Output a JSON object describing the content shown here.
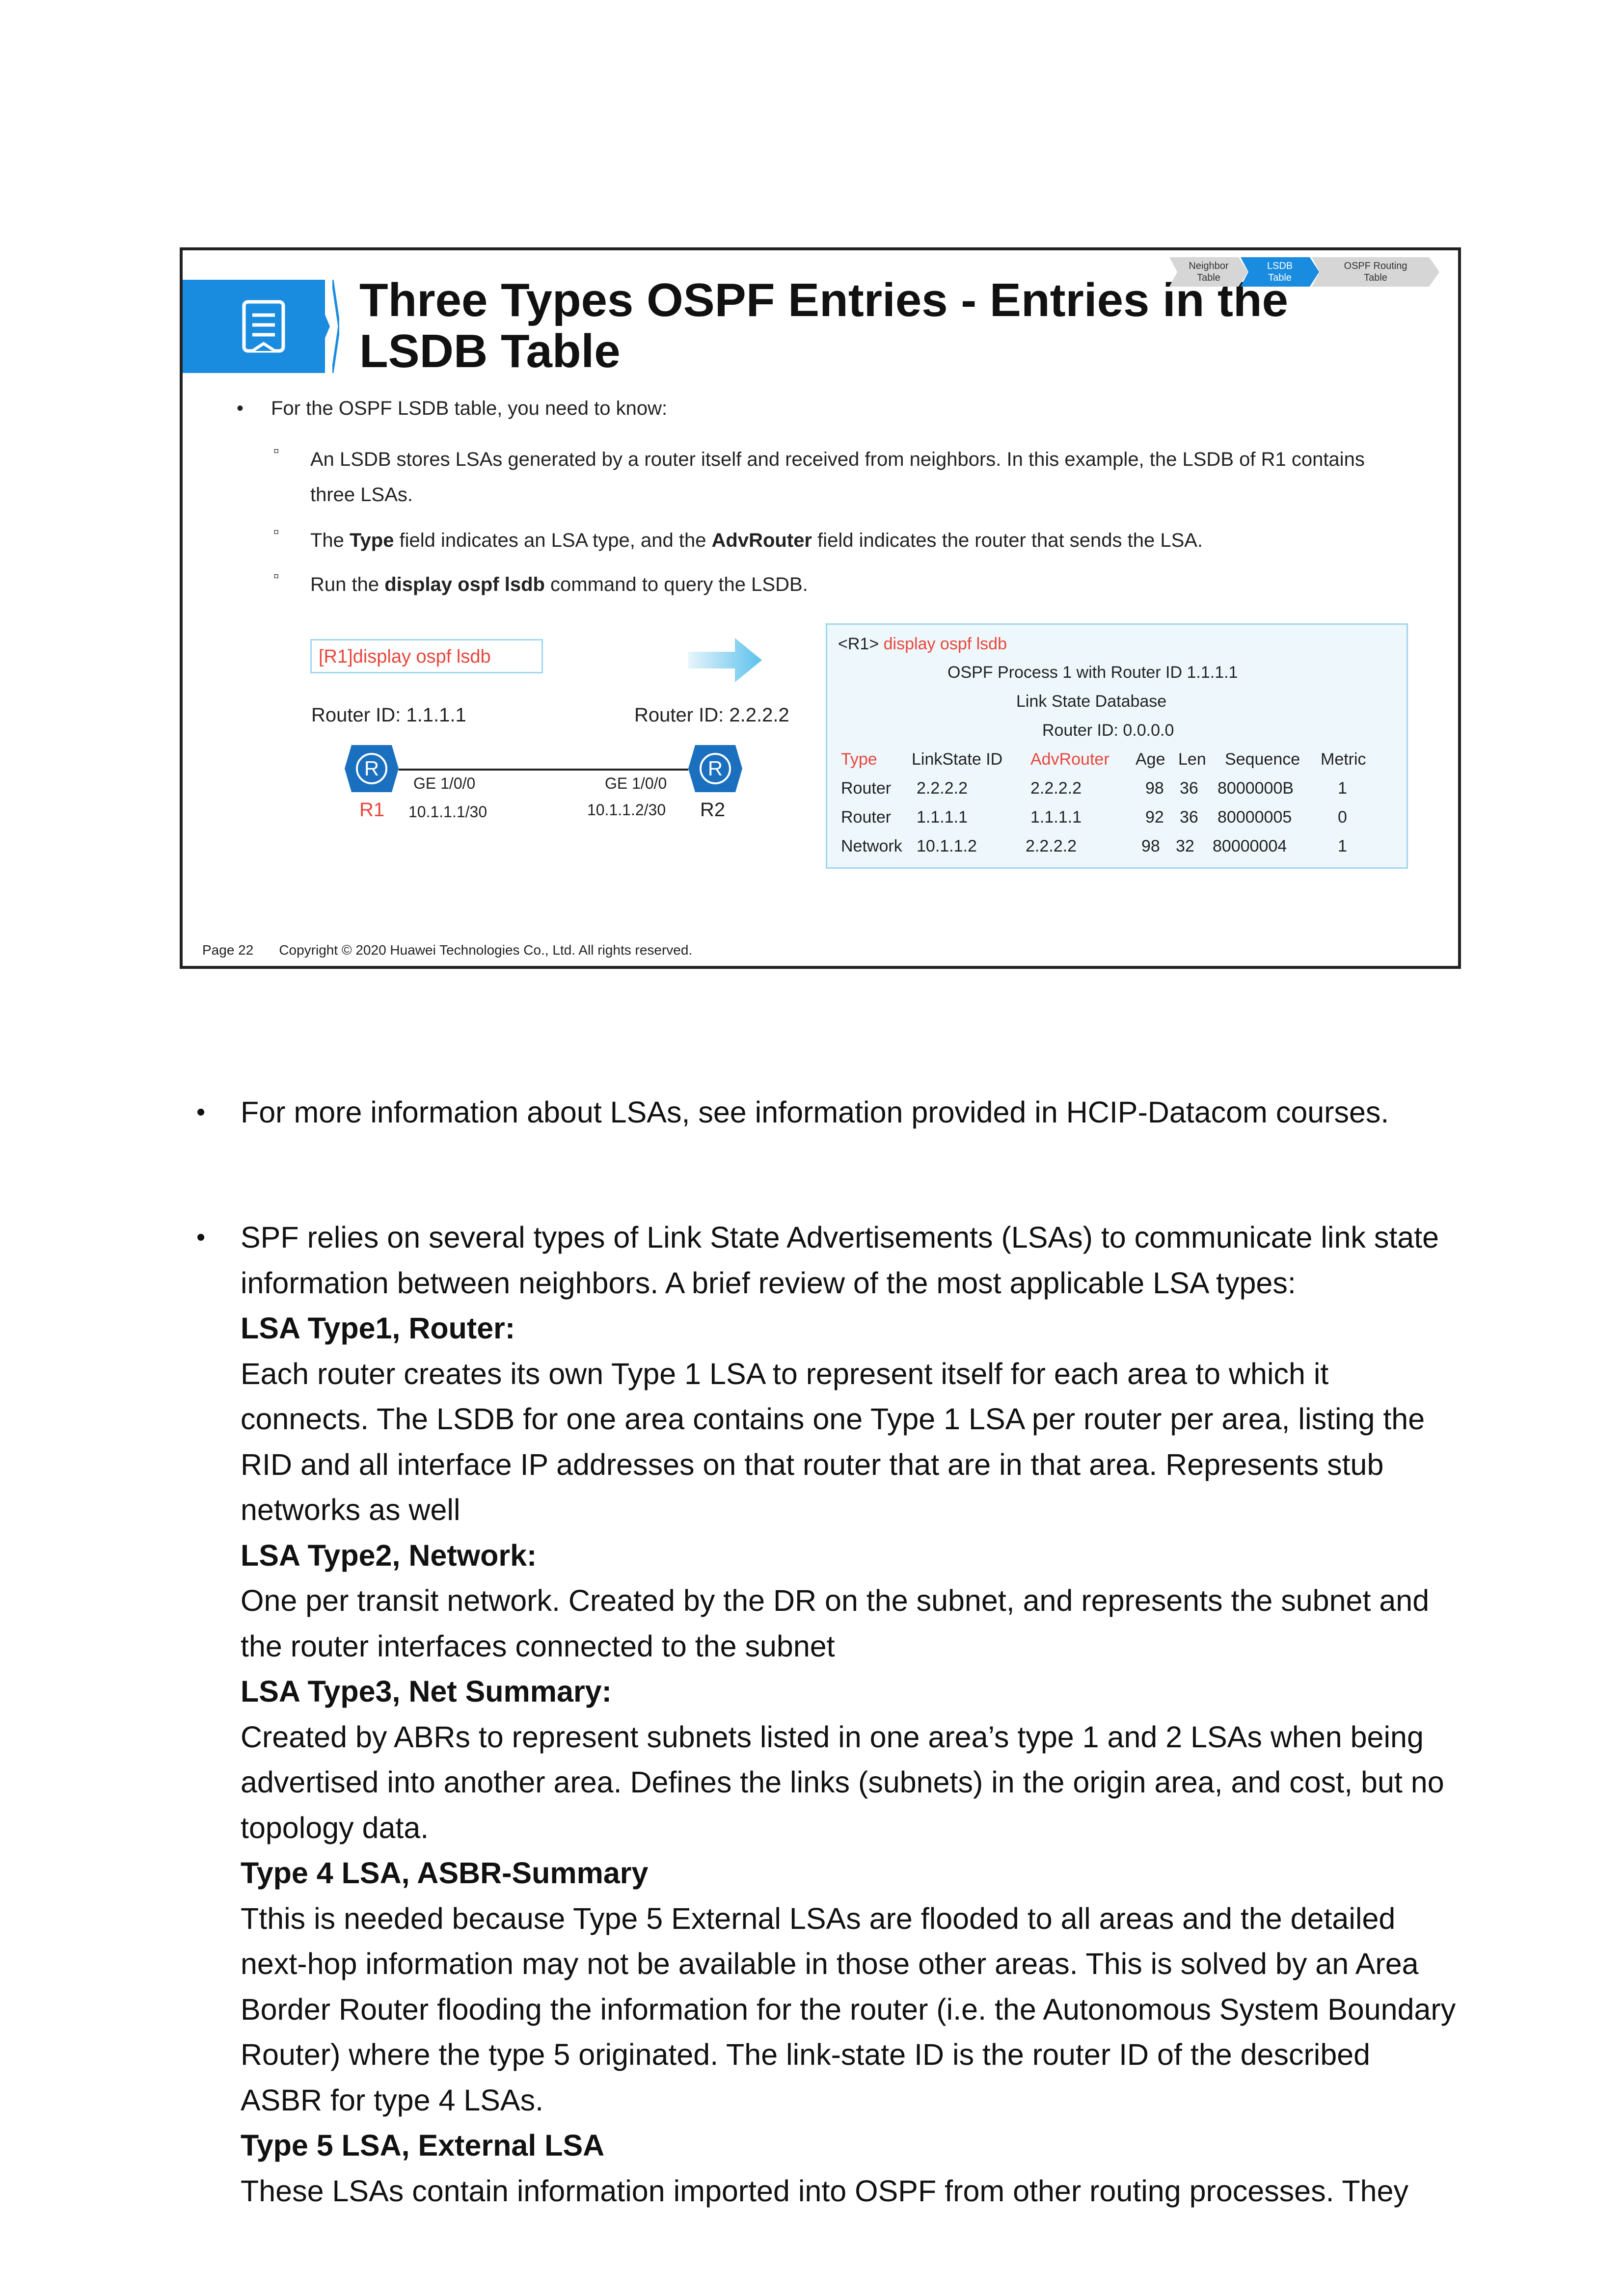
{
  "slide": {
    "title": "Three Types OSPF Entries - Entries in the LSDB Table",
    "tabs": [
      {
        "line1": "Neighbor",
        "line2": "Table"
      },
      {
        "line1": "LSDB",
        "line2": "Table"
      },
      {
        "line1": "OSPF Routing",
        "line2": "Table"
      }
    ],
    "bullet_main": "For the OSPF LSDB table, you need to know:",
    "sub1": "An LSDB stores LSAs generated by a router itself and received from neighbors. In this example, the LSDB of R1 contains three LSAs.",
    "sub2": {
      "a": "The ",
      "b": "Type",
      "c": " field indicates an LSA type, and the ",
      "d": "AdvRouter",
      "e": " field indicates the router that sends the LSA."
    },
    "sub3": {
      "a": "Run the ",
      "b": "display ospf lsdb",
      "c": " command to query the LSDB."
    },
    "cmd": "[R1]display ospf lsdb",
    "rid_left": "Router ID: 1.1.1.1",
    "rid_right": "Router ID: 2.2.2.2",
    "ge_left": "GE 1/0/0",
    "ge_right": "GE 1/0/0",
    "r1": "R1",
    "r2": "R2",
    "ip_left": "10.1.1.1/30",
    "ip_right": "10.1.1.2/30",
    "router_glyph": "R",
    "lsdb": {
      "prompt": "<R1>",
      "cmd": "display ospf lsdb",
      "process": "OSPF Process 1 with Router ID 1.1.1.1",
      "db": "Link State Database",
      "area": "Router ID: 0.0.0.0",
      "headers": [
        "Type",
        "LinkState ID",
        "AdvRouter",
        "Age",
        "Len",
        "Sequence",
        "Metric"
      ],
      "rows": [
        [
          "Router",
          "2.2.2.2",
          "2.2.2.2",
          "98",
          "36",
          "8000000B",
          "1"
        ],
        [
          "Router",
          "1.1.1.1",
          "1.1.1.1",
          "92",
          "36",
          "80000005",
          "0"
        ],
        [
          "Network",
          "10.1.1.2",
          "2.2.2.2",
          "98",
          "32",
          "80000004",
          "1"
        ]
      ]
    },
    "page": "Page 22",
    "copyright": "Copyright © 2020 Huawei Technologies Co., Ltd. All rights reserved."
  },
  "notes": {
    "bullet1": "For more information about LSAs, see information provided in HCIP-Datacom courses.",
    "bullet2_intro": "SPF relies on several types of Link State Advertisements (LSAs) to communicate link state information between neighbors. A brief review of the most applicable LSA types:",
    "sections": [
      {
        "head": "LSA Type1, Router:",
        "text": "Each router creates its own Type 1 LSA to represent itself for each area to which it connects. The LSDB for one area contains one Type 1 LSA per router per area, listing the RID and all interface IP addresses on that router that are in that area. Represents stub networks as well"
      },
      {
        "head": "LSA Type2, Network:",
        "text": "One per transit network. Created by the DR on the subnet, and represents the subnet and the router interfaces connected to the subnet"
      },
      {
        "head": "LSA Type3, Net Summary:",
        "text": "Created by ABRs to represent subnets listed in one area’s type 1 and 2 LSAs when being advertised into another area. Defines the links (subnets) in the origin area, and cost, but no topology data."
      },
      {
        "head": "Type 4 LSA, ASBR-Summary",
        "text": "Tthis is needed because Type 5 External LSAs are flooded to all areas and the detailed next-hop information may not be available in those other areas. This is solved by an Area Border Router flooding the information for the router (i.e. the Autonomous System Boundary Router) where the type 5 originated. The link-state ID is the router ID of the described ASBR for type 4 LSAs."
      },
      {
        "head": "Type 5 LSA, External LSA",
        "text": "These LSAs contain information imported into OSPF from other routing processes. They"
      }
    ]
  }
}
